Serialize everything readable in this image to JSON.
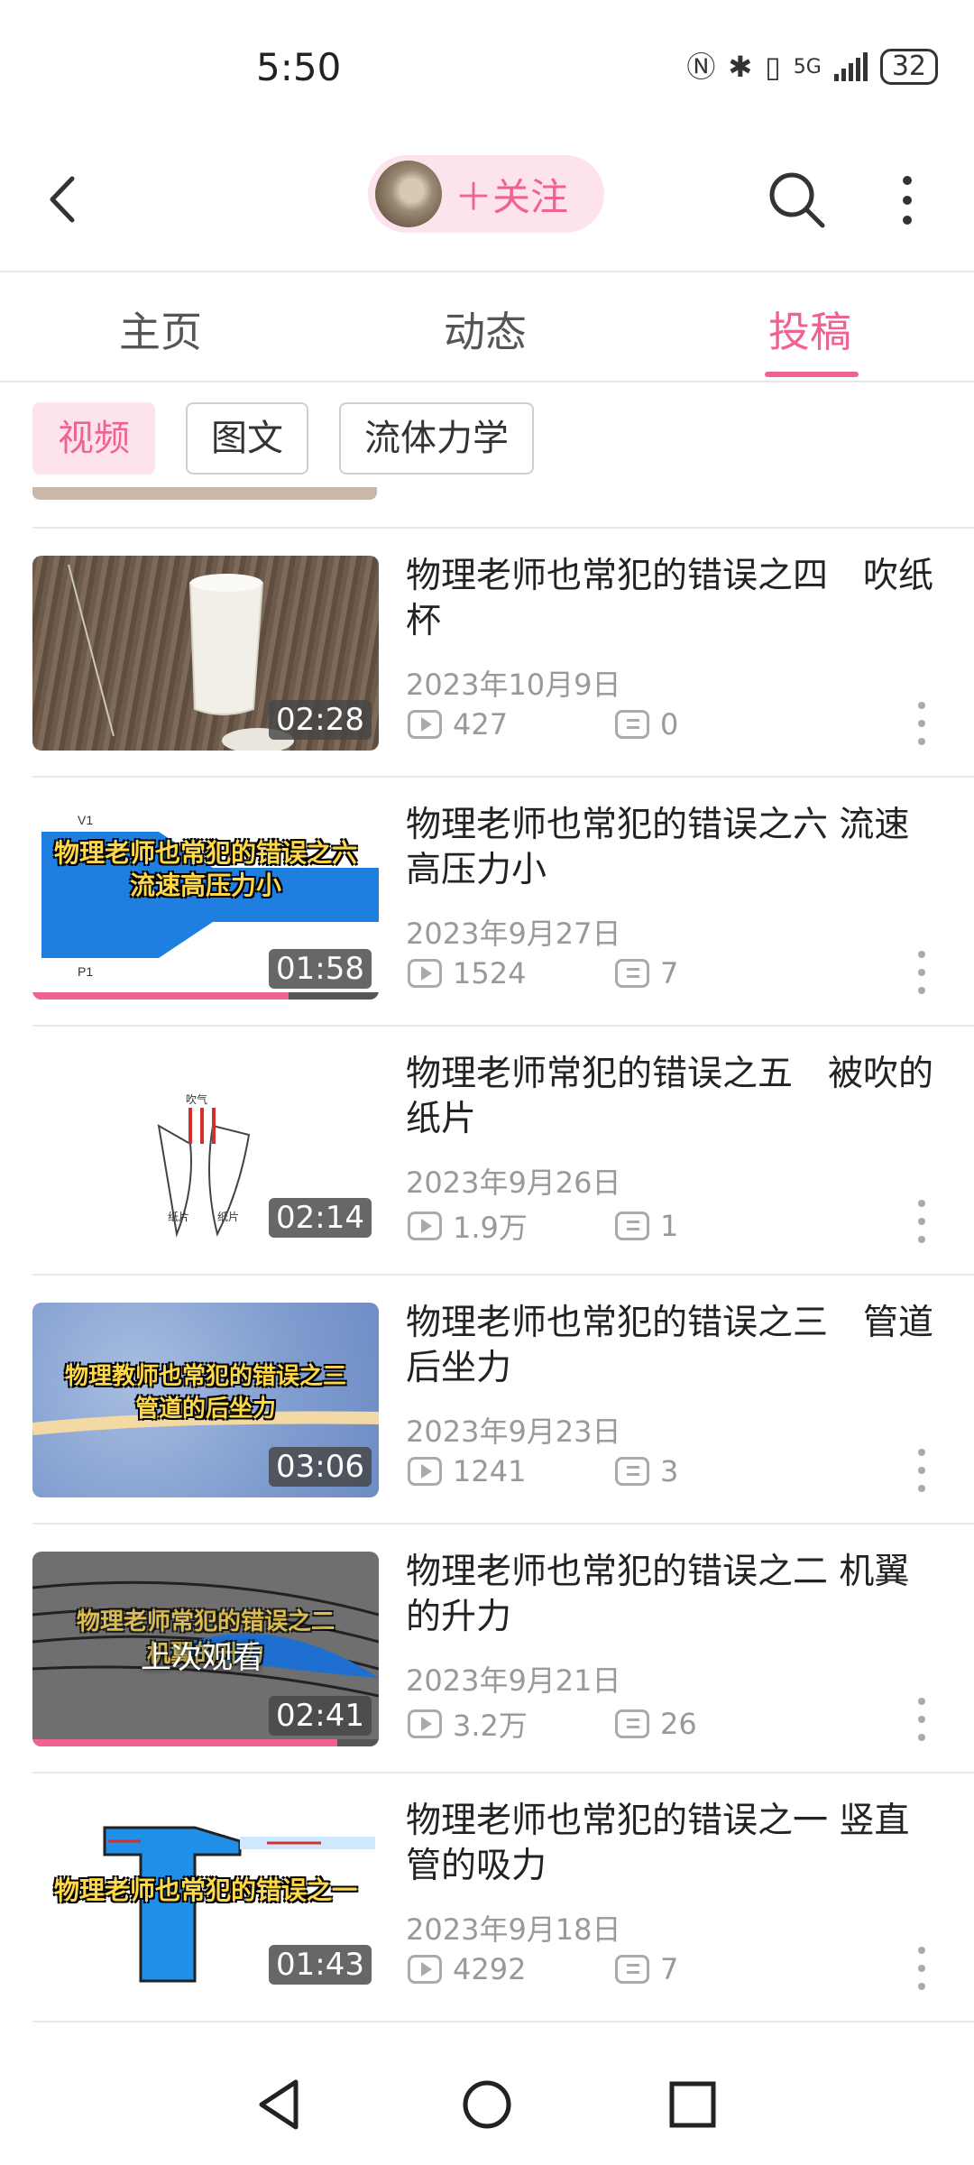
{
  "status_bar": {
    "time": "5:50",
    "network": "5G",
    "battery": "32"
  },
  "header": {
    "follow_label": "＋关注"
  },
  "tabs": [
    {
      "label": "主页",
      "active": false
    },
    {
      "label": "动态",
      "active": false
    },
    {
      "label": "投稿",
      "active": true
    }
  ],
  "filters": [
    {
      "label": "视频",
      "active": true
    },
    {
      "label": "图文",
      "active": false
    },
    {
      "label": "流体力学",
      "active": false
    }
  ],
  "accent_color": "#f06292",
  "videos": [
    {
      "title": "物理老师也常犯的错误之四　吹纸杯",
      "date": "2023年10月9日",
      "views": "427",
      "comments": "0",
      "duration": "02:28"
    },
    {
      "title": "物理老师也常犯的错误之六  流速高压力小",
      "date": "2023年9月27日",
      "views": "1524",
      "comments": "7",
      "duration": "01:58",
      "overlay": "物理老师也常犯的错误之六\n流速高压力小",
      "watch_progress": 0.74
    },
    {
      "title": "物理老师常犯的错误之五　被吹的纸片",
      "date": "2023年9月26日",
      "views": "1.9万",
      "comments": "1",
      "duration": "02:14",
      "diagram_labels": [
        "吹气",
        "纸片",
        "纸片"
      ]
    },
    {
      "title": "物理老师也常犯的错误之三　管道后坐力",
      "date": "2023年9月23日",
      "views": "1241",
      "comments": "3",
      "duration": "03:06",
      "overlay": "物理教师也常犯的错误之三\n管道的后坐力"
    },
    {
      "title": "物理老师也常犯的错误之二 机翼的升力",
      "date": "2023年9月21日",
      "views": "3.2万",
      "comments": "26",
      "duration": "02:41",
      "overlay": "物理老师常犯的错误之二\n机翼的升力",
      "resume_label": "上次观看",
      "watch_progress": 0.88
    },
    {
      "title": "物理老师也常犯的错误之一 竖直管的吸力",
      "date": "2023年9月18日",
      "views": "4292",
      "comments": "7",
      "duration": "01:43",
      "overlay": "物理老师也常犯的错误之一"
    }
  ]
}
